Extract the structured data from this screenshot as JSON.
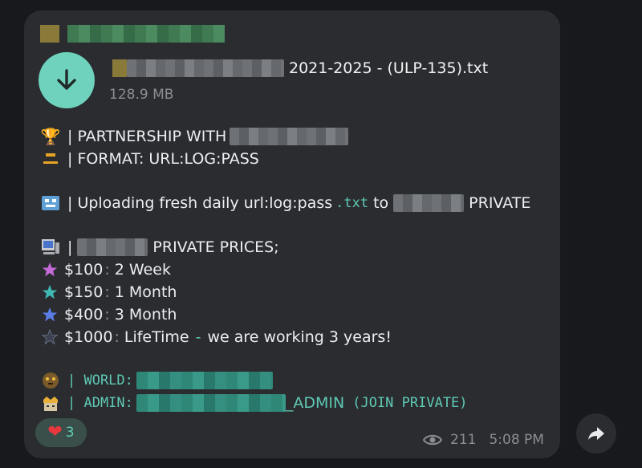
{
  "file": {
    "name_suffix": "2021-2025 - (ULP-135).txt",
    "size": "128.9 MB"
  },
  "message": {
    "partnership": "| PARTNERSHIP WITH",
    "format": "| FORMAT: URL:LOG:PASS",
    "upload_prefix": "| Uploading fresh daily url:log:pass",
    "upload_ext": ".txt",
    "upload_to": "to",
    "upload_private": "PRIVATE",
    "prices_sep": "|",
    "prices_title": "PRIVATE PRICES;",
    "prices": [
      {
        "price": "$100",
        "colon": ":",
        "term": "2 Week",
        "icon": "purple-star-icon",
        "color": "#c46ad9"
      },
      {
        "price": "$150",
        "colon": ":",
        "term": "1 Month",
        "icon": "teal-star-icon",
        "color": "#3fb8b4"
      },
      {
        "price": "$400",
        "colon": ":",
        "term": "3 Month",
        "icon": "blue-star-icon",
        "color": "#5b7ee6"
      },
      {
        "price": "$1000",
        "colon": ":",
        "term": "LifeTime",
        "dash": "-",
        "note": "we are working 3 years!",
        "icon": "dark-star-icon",
        "color": "#3b4150"
      }
    ],
    "world_label": "| WORLD:",
    "admin_label": "| ADMIN:",
    "admin_suffix": "_ADMIN",
    "admin_note": "(JOIN PRIVATE)"
  },
  "reaction": {
    "count": "3",
    "icon": "heart-icon"
  },
  "meta": {
    "views": "211",
    "time": "5:08 PM",
    "views_icon": "eye-icon"
  },
  "colors": {
    "accent": "#6fd2bd",
    "link": "#5fcab4",
    "bubble": "#2a2c30",
    "background": "#17191c"
  }
}
